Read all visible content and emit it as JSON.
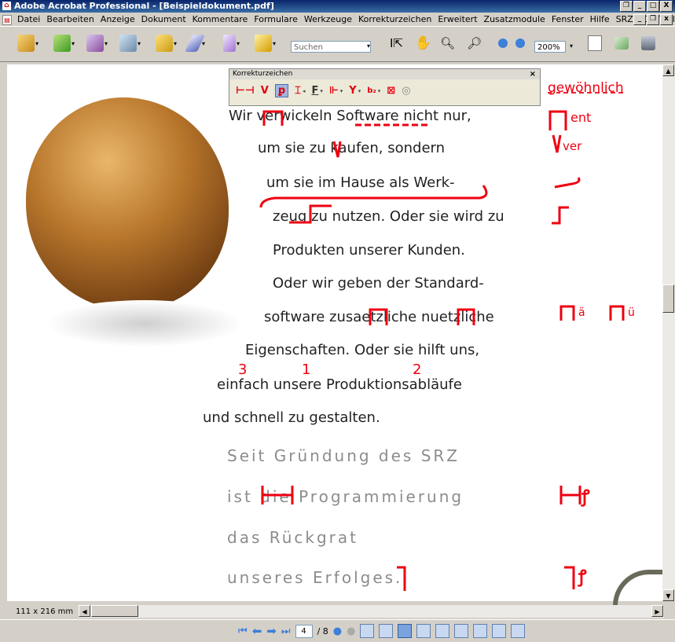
{
  "window": {
    "title": "Adobe Acrobat Professional - [Beispieldokument.pdf]",
    "buttons": [
      "_",
      "□",
      "X"
    ]
  },
  "menubar": {
    "items": [
      "Datei",
      "Bearbeiten",
      "Anzeige",
      "Dokument",
      "Kommentare",
      "Formulare",
      "Werkzeuge",
      "Korrekturzeichen",
      "Erweitert",
      "Zusatzmodule",
      "Fenster",
      "Hilfe",
      "SRZ: PDF-Tools"
    ]
  },
  "toolbar": {
    "search_placeholder": "Suchen",
    "zoom_value": "200%",
    "icons": [
      "create-pdf-icon",
      "combine-files-icon",
      "export-icon",
      "send-icon",
      "secure-icon",
      "sign-icon",
      "forms-icon",
      "review-icon",
      "select-tool-icon",
      "hand-tool-icon",
      "zoom-marquee-icon",
      "zoom-in-glass-icon",
      "zoom-out-icon",
      "zoom-in-icon",
      "fit-page-icon",
      "pages-icon",
      "print-icon"
    ]
  },
  "palette": {
    "title": "Korrekturzeichen",
    "close": "×"
  },
  "document": {
    "body_lines": [
      "Wir verwickeln Software nicht nur,",
      "um sie zu kaufen, sondern",
      "um sie im Hause als Werk-",
      "zeug zu nutzen. Oder sie wird zu",
      "Produkten unserer Kunden.",
      "Oder wir geben der Standard-",
      "software zusaetzliche nuetzliche",
      "Eigenschaften. Oder sie hilft uns,",
      "einfach unsere Produktionsabläufe",
      "und schnell zu gestalten."
    ],
    "gray_lines": [
      "Seit Gründung des SRZ",
      "ist die Programmierung",
      "das Rückgrat",
      "unseres Erfolges."
    ],
    "margin_marks": {
      "m1": "gewöhnlich",
      "m2": "ent",
      "m3": "ver",
      "m4": "ä",
      "m5": "ü"
    },
    "order_numbers": [
      "3",
      "1",
      "2"
    ]
  },
  "footer": {
    "page_size": "111 x 216 mm",
    "page_current": "4",
    "page_total": "/ 8"
  },
  "colors": {
    "mark_red": "#ee0010",
    "titlebar": "#0a246a"
  }
}
